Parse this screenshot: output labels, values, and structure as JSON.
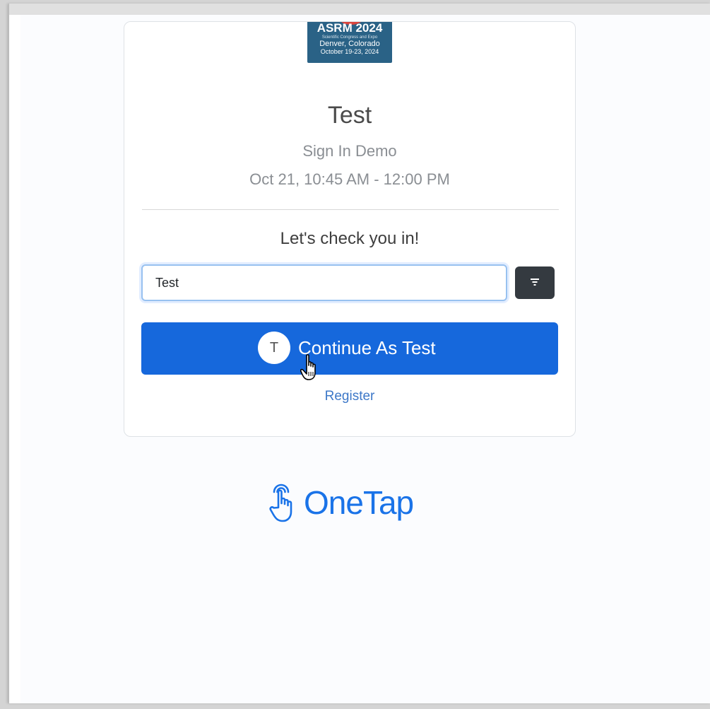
{
  "event": {
    "logo": {
      "title": "ASRM 2024",
      "tagline": "Scientific Congress and Expo",
      "location": "Denver, Colorado",
      "dates": "October 19-23, 2024"
    },
    "title": "Test",
    "subtitle": "Sign In Demo",
    "time": "Oct 21, 10:45 AM - 12:00 PM"
  },
  "checkin": {
    "prompt": "Let's check you in!",
    "search_value": "Test",
    "filter_icon": "filter-icon",
    "continue_avatar": "T",
    "continue_label": "Continue As Test",
    "register_label": "Register"
  },
  "brand": {
    "name": "OneTap",
    "color": "#1a73e8"
  },
  "colors": {
    "primary": "#1668dc",
    "dark_button": "#343a40"
  }
}
